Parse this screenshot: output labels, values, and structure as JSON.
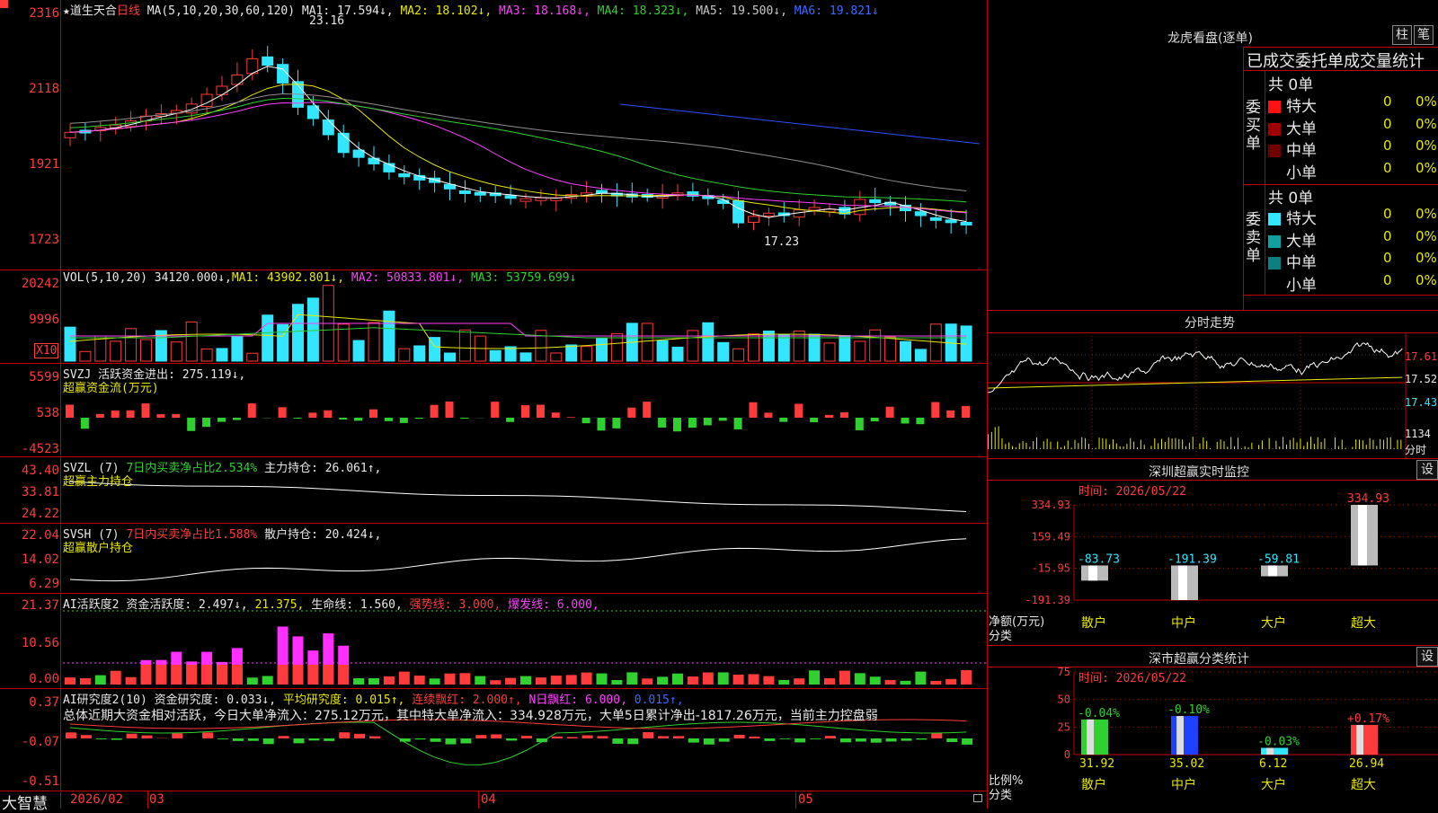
{
  "colors": {
    "up": "#ff3b3b",
    "down": "#32e6ff",
    "grid": "#c00000",
    "ma1": "#ffffff",
    "ma2": "#e8e800",
    "ma3": "#ff40ff",
    "ma4": "#30d030",
    "ma5": "#909090",
    "ma6": "#3050ff"
  },
  "left": {
    "price_axis": [
      "2316",
      "2118",
      "1921",
      "1723"
    ],
    "header": {
      "star": "★",
      "stock_name": "道生天合",
      "period": "日线",
      "ma_params": "MA(5,10,20,30,60,120)",
      "ma1": "MA1: 17.594↓,",
      "ma2": "MA2: 18.102↓,",
      "ma3": "MA3: 18.168↓,",
      "ma4": "MA4: 18.323↓,",
      "ma5": "MA5: 19.500↓,",
      "ma6": "MA6: 19.821↓"
    },
    "price_high": "23.16",
    "price_low": "17.23",
    "vol": {
      "axis": [
        "20242",
        "9996"
      ],
      "unit": "X10",
      "header": "VOL(5,10,20)",
      "value": "34120.000↓,",
      "ma1": "MA1: 43902.801↓,",
      "ma2": "MA2: 50833.801↓,",
      "ma3": "MA3: 53759.699↓"
    },
    "svzj": {
      "axis": [
        "5599",
        "538",
        "-4523"
      ],
      "line1": "SVZJ  活跃资金进出: 275.119↓,",
      "line2": "超赢资金流(万元)"
    },
    "svzl": {
      "axis": [
        "43.40",
        "33.81",
        "24.22"
      ],
      "name": "SVZL (7)",
      "desc": "7日内买卖净占比2.534%",
      "val": "主力持仓: 26.061↑,",
      "sub": "超赢主力持仓"
    },
    "svsh": {
      "axis": [
        "22.04",
        "14.02",
        "6.29"
      ],
      "name": "SVSH (7)",
      "desc": "7日内买卖净占比1.588%",
      "val": "散户持仓: 20.424↓,",
      "sub": "超赢散户持仓"
    },
    "ai1": {
      "axis": [
        "21.37",
        "10.56",
        "0.00"
      ],
      "name": "AI活跃度2",
      "v1": "资金活跃度: 2.497↓,",
      "v2": "21.375,",
      "v3": "生命线: 1.560,",
      "v4": "强势线: 3.000,",
      "v5": "爆发线: 6.000,"
    },
    "ai2": {
      "axis": [
        "0.37",
        "-0.07",
        "-0.51"
      ],
      "name": "AI研究度2(10)",
      "v1": "资金研究度: 0.033↓,",
      "v2": "平均研究度: 0.015↑,",
      "v3": "连续飘红: 2.000↑,",
      "v4": "N日飘红: 6.000,",
      "v5": "0.015↑,",
      "summary": "总体近期大资金相对活跃，今日大单净流入：275.12万元，其中特大单净流入：334.928万元，大单5日累计净出-1817.26万元，当前主力控盘弱"
    },
    "bottom": {
      "brand": "大智慧",
      "dates": [
        "2026/02",
        "03",
        "04",
        "05"
      ]
    }
  },
  "right": {
    "lhb": {
      "title": "龙虎看盘(逐单)",
      "btn1": "柱",
      "btn2": "笔",
      "subtitle": "已成交委托单成交量统计",
      "buy": {
        "label": "委买单",
        "total": "共 0单",
        "rows": [
          {
            "name": "特大",
            "val": "0",
            "pct": "0%",
            "color": "#ff1010"
          },
          {
            "name": "大单",
            "val": "0",
            "pct": "0%",
            "color": "#a00000"
          },
          {
            "name": "中单",
            "val": "0",
            "pct": "0%",
            "color": "#700000"
          },
          {
            "name": "小单",
            "val": "0",
            "pct": "0%",
            "color": "#000000"
          }
        ]
      },
      "sell": {
        "label": "委卖单",
        "total": "共 0单",
        "rows": [
          {
            "name": "特大",
            "val": "0",
            "pct": "0%",
            "color": "#32e6ff"
          },
          {
            "name": "大单",
            "val": "0",
            "pct": "0%",
            "color": "#10a0a0"
          },
          {
            "name": "中单",
            "val": "0",
            "pct": "0%",
            "color": "#0c8080"
          },
          {
            "name": "小单",
            "val": "0",
            "pct": "0%",
            "color": "#000000"
          }
        ]
      }
    },
    "intraday": {
      "title": "分时走势",
      "axis": [
        "17.61",
        "17.52",
        "17.43",
        "1134"
      ],
      "vol_unit": "分时"
    },
    "monitor": {
      "title": "深圳超赢实时监控",
      "btn": "设",
      "time": "时间: 2026/05/22",
      "axis": [
        "334.93",
        "159.49",
        "-15.95",
        "-191.39"
      ],
      "ylabel": "净额(万元)",
      "xlabel": "分类",
      "bars": [
        {
          "label": "散户",
          "value": -83.73,
          "text": "-83.73"
        },
        {
          "label": "中户",
          "value": -191.39,
          "text": "-191.39"
        },
        {
          "label": "大户",
          "value": -59.81,
          "text": "-59.81"
        },
        {
          "label": "超大",
          "value": 334.93,
          "text": "334.93"
        }
      ]
    },
    "stats": {
      "title": "深市超赢分类统计",
      "btn": "设",
      "time": "时间: 2026/05/22",
      "axis": [
        "75",
        "50",
        "25",
        "0"
      ],
      "ylabel": "比例%",
      "xlabel": "分类",
      "bars": [
        {
          "label": "散户",
          "value": 31.92,
          "text": "31.92",
          "delta": "-0.04%",
          "color": "#30d030"
        },
        {
          "label": "中户",
          "value": 35.02,
          "text": "35.02",
          "delta": "-0.10%",
          "color": "#2040ff"
        },
        {
          "label": "大户",
          "value": 6.12,
          "text": "6.12",
          "delta": "-0.03%",
          "color": "#32e6ff"
        },
        {
          "label": "超大",
          "value": 26.94,
          "text": "26.94",
          "delta": "+0.17%",
          "color": "#ff3b3b"
        }
      ]
    }
  }
}
